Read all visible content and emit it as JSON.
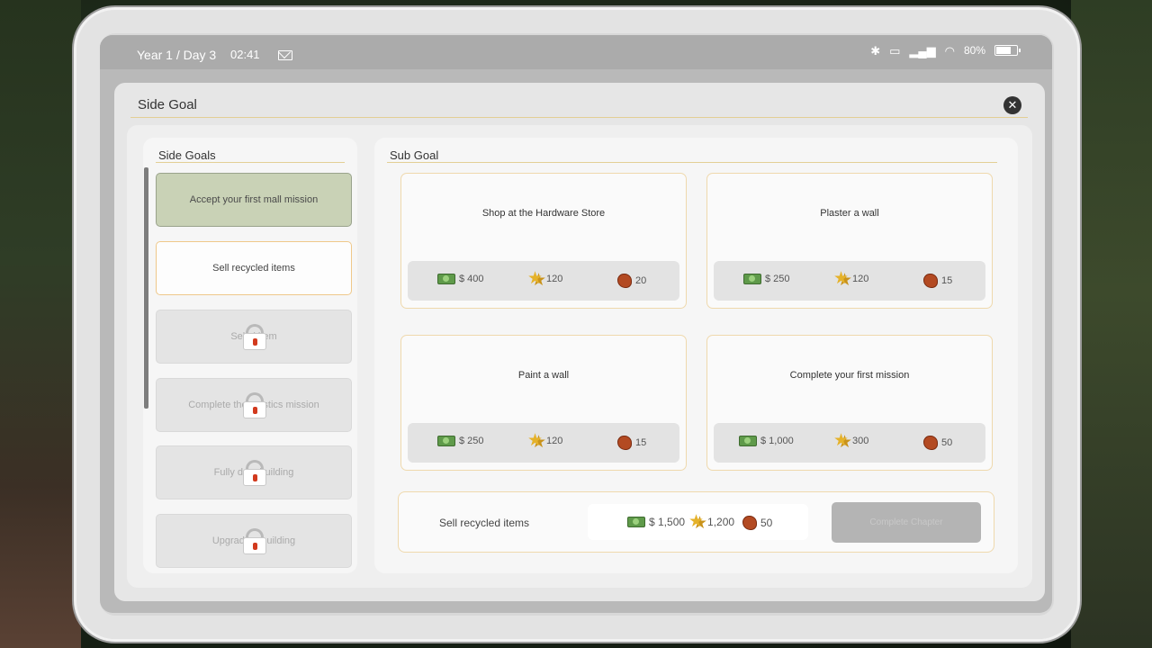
{
  "status_bar": {
    "date": "Year 1 / Day 3",
    "time": "02:41",
    "battery": "80%",
    "battery_level": 0.8,
    "icons": [
      "mail-icon",
      "bluetooth-icon",
      "sim-icon",
      "signal-icon",
      "wifi-icon",
      "battery-icon"
    ]
  },
  "panel": {
    "title": "Side Goal",
    "close_icon": "close-icon"
  },
  "side_goals": {
    "title": "Side Goals",
    "items": [
      {
        "label": "Accept your first mall mission",
        "state": "active"
      },
      {
        "label": "Sell recycled items",
        "state": "open"
      },
      {
        "label": "Sell d item",
        "state": "locked"
      },
      {
        "label": "Complete the ogistics mission",
        "state": "locked"
      },
      {
        "label": "Fully de a building",
        "state": "locked"
      },
      {
        "label": "Upgrade e building",
        "state": "locked"
      }
    ]
  },
  "sub_goal": {
    "title": "Sub Goal",
    "cards": [
      {
        "title": "Shop at the Hardware Store",
        "cash": "$ 400",
        "xp": "120",
        "brick": "20"
      },
      {
        "title": "Plaster a wall",
        "cash": "$ 250",
        "xp": "120",
        "brick": "15"
      },
      {
        "title": "Paint a wall",
        "cash": "$ 250",
        "xp": "120",
        "brick": "15"
      },
      {
        "title": "Complete your first mission",
        "cash": "$ 1,000",
        "xp": "300",
        "brick": "50"
      }
    ],
    "chapter": {
      "title": "Sell recycled items",
      "cash": "$ 1,500",
      "xp": "1,200",
      "brick": "50",
      "button_label": "Complete Chapter"
    }
  },
  "colors": {
    "accent_border": "#efd9ad",
    "active_goal": "#c9d2b6",
    "cash": "#5f9a4a",
    "star": "#e5b22a",
    "brick": "#b34a22"
  }
}
